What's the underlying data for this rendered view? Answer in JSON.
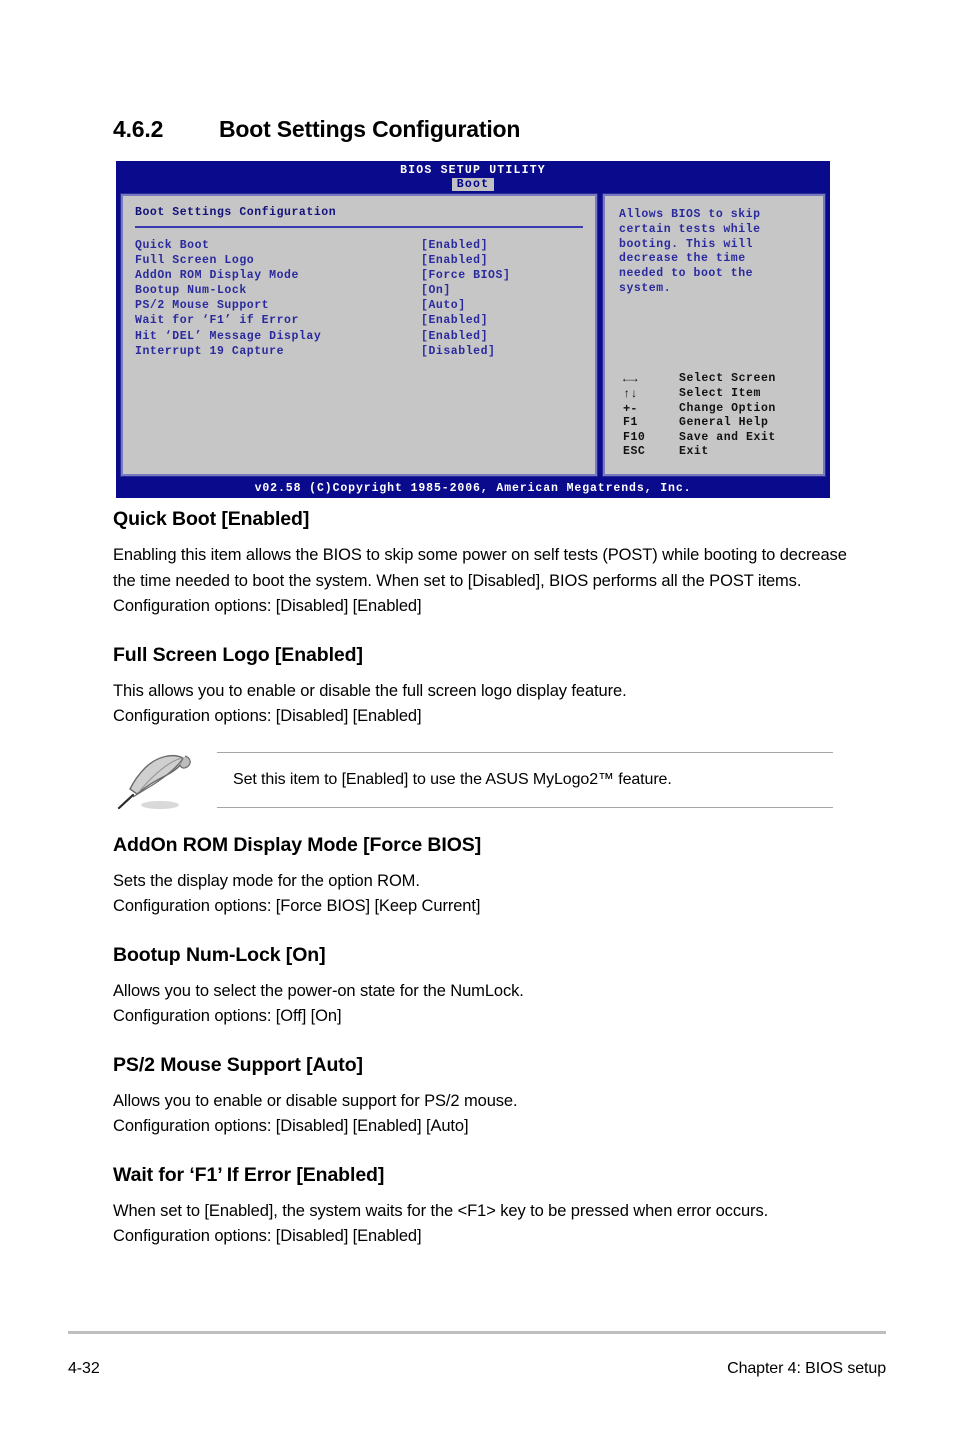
{
  "section": {
    "number": "4.6.2",
    "title": "Boot Settings Configuration"
  },
  "bios": {
    "utility_title": "BIOS SETUP UTILITY",
    "active_tab": "Boot",
    "panel_title": "Boot Settings Configuration",
    "options": [
      {
        "name": "Quick Boot",
        "value": "[Enabled]"
      },
      {
        "name": "Full Screen Logo",
        "value": "[Enabled]"
      },
      {
        "name": "AddOn ROM Display Mode",
        "value": "[Force BIOS]"
      },
      {
        "name": "Bootup Num-Lock",
        "value": "[On]"
      },
      {
        "name": "PS/2 Mouse Support",
        "value": "[Auto]"
      },
      {
        "name": "Wait for ‘F1’ if Error",
        "value": "[Enabled]"
      },
      {
        "name": "Hit ‘DEL’ Message Display",
        "value": "[Enabled]"
      },
      {
        "name": "Interrupt 19 Capture",
        "value": "[Disabled]"
      }
    ],
    "help_text": "Allows BIOS to skip\ncertain tests while\nbooting. This will\ndecrease the time\nneeded to boot the\nsystem.",
    "legend": [
      {
        "key": "←→",
        "desc": "Select Screen",
        "icon": "left-right-arrow-icon"
      },
      {
        "key": "↑↓",
        "desc": "Select Item",
        "icon": "up-down-arrow-icon"
      },
      {
        "key": "+-",
        "desc": "Change Option",
        "icon": "plus-minus-icon"
      },
      {
        "key": "F1",
        "desc": "General Help",
        "icon": ""
      },
      {
        "key": "F10",
        "desc": "Save and Exit",
        "icon": ""
      },
      {
        "key": "ESC",
        "desc": "Exit",
        "icon": ""
      }
    ],
    "footer": "v02.58 (C)Copyright 1985-2006, American Megatrends, Inc.",
    "colors": {
      "header_blue": "#0a0a8c",
      "panel_gray": "#c6c6c6",
      "text_blue": "#2a2a9e",
      "tab_bg": "#c0c0c0"
    }
  },
  "body": {
    "items": [
      {
        "heading": "Quick Boot [Enabled]",
        "text": "Enabling this item allows the BIOS to skip some power on self tests (POST) while booting to decrease the time needed to boot the system. When set to [Disabled], BIOS performs all the POST items. Configuration options: [Disabled] [Enabled]"
      },
      {
        "heading": "Full Screen Logo [Enabled]",
        "text": "This allows you to enable or disable the full screen logo display feature.\nConfiguration options: [Disabled] [Enabled]"
      },
      {
        "heading": "AddOn ROM Display Mode [Force BIOS]",
        "text": "Sets the display mode for the option ROM.\nConfiguration options: [Force BIOS] [Keep Current]"
      },
      {
        "heading": "Bootup Num-Lock [On]",
        "text": "Allows you to select the power-on state for the NumLock.\nConfiguration options: [Off] [On]"
      },
      {
        "heading": "PS/2 Mouse Support [Auto]",
        "text": "Allows you to enable or disable support for PS/2 mouse.\nConfiguration options: [Disabled] [Enabled] [Auto]"
      },
      {
        "heading": "Wait for ‘F1’ If Error [Enabled]",
        "text": "When set to [Enabled], the system waits for the <F1> key to be pressed when error occurs. Configuration options: [Disabled] [Enabled]"
      }
    ],
    "note": {
      "icon": "quill-pen-icon",
      "text": "Set this item to [Enabled] to use the ASUS MyLogo2™ feature."
    }
  },
  "page_footer": {
    "page_number": "4-32",
    "chapter": "Chapter 4: BIOS setup"
  }
}
